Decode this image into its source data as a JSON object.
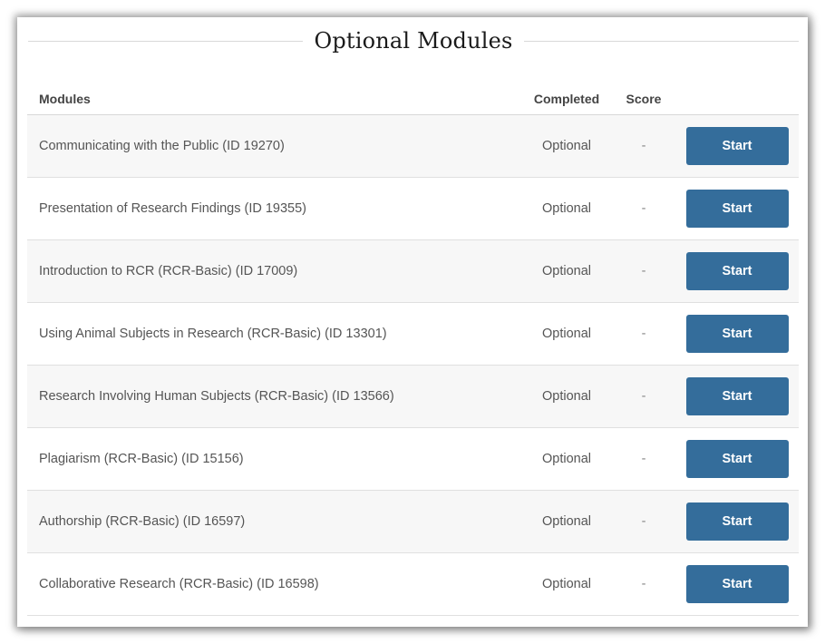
{
  "section": {
    "title": "Optional Modules"
  },
  "table": {
    "headers": {
      "module": "Modules",
      "completed": "Completed",
      "score": "Score",
      "action": ""
    },
    "rows": [
      {
        "module": "Communicating with the Public (ID 19270)",
        "completed": "Optional",
        "score": "-",
        "action": "Start"
      },
      {
        "module": "Presentation of Research Findings (ID 19355)",
        "completed": "Optional",
        "score": "-",
        "action": "Start"
      },
      {
        "module": "Introduction to RCR (RCR-Basic) (ID 17009)",
        "completed": "Optional",
        "score": "-",
        "action": "Start"
      },
      {
        "module": "Using Animal Subjects in Research (RCR-Basic) (ID 13301)",
        "completed": "Optional",
        "score": "-",
        "action": "Start"
      },
      {
        "module": "Research Involving Human Subjects (RCR-Basic) (ID 13566)",
        "completed": "Optional",
        "score": "-",
        "action": "Start"
      },
      {
        "module": "Plagiarism (RCR-Basic) (ID 15156)",
        "completed": "Optional",
        "score": "-",
        "action": "Start"
      },
      {
        "module": "Authorship (RCR-Basic) (ID 16597)",
        "completed": "Optional",
        "score": "-",
        "action": "Start"
      },
      {
        "module": "Collaborative Research (RCR-Basic) (ID 16598)",
        "completed": "Optional",
        "score": "-",
        "action": "Start"
      }
    ]
  },
  "colors": {
    "button_bg": "#346d9b",
    "button_text": "#ffffff",
    "row_alt_bg": "#f7f7f7"
  }
}
